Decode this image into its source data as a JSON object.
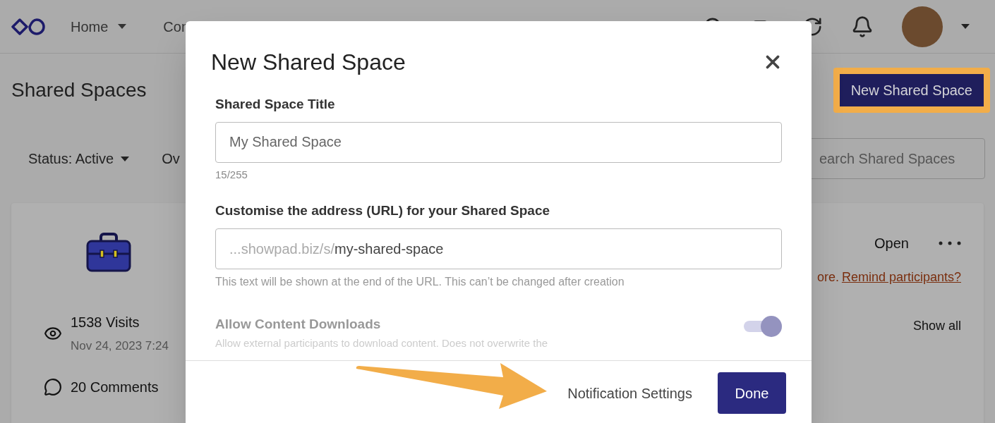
{
  "header": {
    "nav": [
      {
        "label": "Home",
        "dropdown": true
      },
      {
        "label": "Con",
        "dropdown": false
      }
    ]
  },
  "page": {
    "title": "Shared Spaces",
    "new_button": "New Shared Space",
    "highlighted": true,
    "filters": [
      {
        "label": "Status: Active",
        "dropdown": true
      },
      {
        "label": "Ov",
        "dropdown": false
      }
    ],
    "search": {
      "placeholder": "earch Shared Spaces"
    }
  },
  "card": {
    "stats": [
      {
        "kind": "visits",
        "label": "1538 Visits",
        "date": "Nov 24, 2023 7:24"
      },
      {
        "kind": "comments",
        "label": "20 Comments"
      }
    ],
    "open": "Open",
    "notice": "ore.",
    "notice_link": "Remind participants?",
    "show_all": "Show all"
  },
  "modal": {
    "title": "New Shared Space",
    "fields": [
      {
        "label": "Shared Space Title",
        "placeholder": "My Shared Space",
        "counter": "15/255"
      },
      {
        "label": "Customise the address (URL) for your Shared Space",
        "prefix": "...showpad.biz/s/",
        "value": "my-shared-space",
        "hint": "This text will be shown at the end of the URL. This can’t be changed after creation"
      }
    ],
    "toggle": {
      "label": "Allow Content Downloads",
      "description": "Allow external participants to download content. Does not overwrite the",
      "on": true,
      "disabled": true
    },
    "footer": {
      "link": "Notification Settings",
      "done": "Done"
    }
  }
}
